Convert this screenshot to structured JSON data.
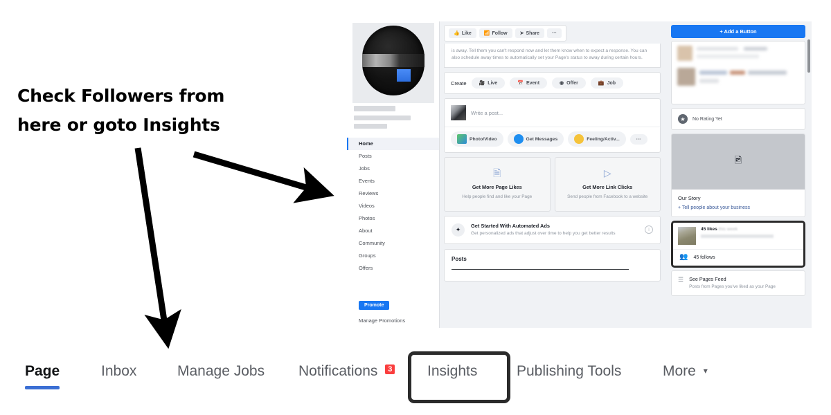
{
  "annotation": {
    "headline_line1": "Check Followers from",
    "headline_line2": "here or goto Insights",
    "arrow_to_stats": "arrow-pointing-to-followers-box",
    "arrow_to_insights": "arrow-pointing-to-insights-tab"
  },
  "tabbar": {
    "tabs": [
      {
        "label": "Page",
        "active": true,
        "badge": null
      },
      {
        "label": "Inbox",
        "active": false,
        "badge": null
      },
      {
        "label": "Manage Jobs",
        "active": false,
        "badge": null
      },
      {
        "label": "Notifications",
        "active": false,
        "badge": "3"
      },
      {
        "label": "Insights",
        "active": false,
        "badge": null,
        "highlighted": true
      },
      {
        "label": "Publishing Tools",
        "active": false,
        "badge": null
      },
      {
        "label": "More",
        "active": false,
        "badge": null,
        "caret": "▾"
      }
    ],
    "active_color": "#3b6fd4",
    "badge_color": "#fa3e3e",
    "highlight_color": "#2b2b2b"
  },
  "screenshot": {
    "left_nav": {
      "items": [
        {
          "label": "Home",
          "active": true
        },
        {
          "label": "Posts",
          "active": false
        },
        {
          "label": "Jobs",
          "active": false
        },
        {
          "label": "Events",
          "active": false
        },
        {
          "label": "Reviews",
          "active": false
        },
        {
          "label": "Videos",
          "active": false
        },
        {
          "label": "Photos",
          "active": false
        },
        {
          "label": "About",
          "active": false
        },
        {
          "label": "Community",
          "active": false
        },
        {
          "label": "Groups",
          "active": false
        },
        {
          "label": "Offers",
          "active": false
        }
      ],
      "promote_label": "Promote",
      "manage_promotions_label": "Manage Promotions"
    },
    "action_bar": {
      "like": "Like",
      "follow": "Follow",
      "share": "Share",
      "more": "···"
    },
    "away_message": "is away. Tell them you can't respond now and let them know when to expect a response. You can also schedule away times to automatically set your Page's status to away during certain hours.",
    "create_row": {
      "label": "Create",
      "items": [
        {
          "label": "Live",
          "icon": "video-camera-icon"
        },
        {
          "label": "Event",
          "icon": "calendar-icon"
        },
        {
          "label": "Offer",
          "icon": "tag-icon"
        },
        {
          "label": "Job",
          "icon": "briefcase-icon"
        }
      ]
    },
    "composer": {
      "placeholder": "Write a post...",
      "actions": [
        {
          "label": "Photo/Video",
          "icon": "photo-icon"
        },
        {
          "label": "Get Messages",
          "icon": "messenger-icon"
        },
        {
          "label": "Feeling/Activ...",
          "icon": "emoji-icon"
        },
        {
          "label": "···",
          "icon": "ellipsis-icon"
        }
      ]
    },
    "promo_cards": [
      {
        "title": "Get More Page Likes",
        "subtitle": "Help people find and like your Page",
        "icon": "page-list-icon"
      },
      {
        "title": "Get More Link Clicks",
        "subtitle": "Send people from Facebook to a website",
        "icon": "cursor-icon"
      }
    ],
    "automated_ads": {
      "title": "Get Started With Automated Ads",
      "subtitle": "Get personalized ads that adjust over time to help you get better results",
      "icon": "magic-wand-icon",
      "info_icon": "info-icon"
    },
    "posts_section": {
      "title": "Posts"
    },
    "right_column": {
      "add_button_label": "+ Add a Button",
      "rating_label": "No Rating Yet",
      "story": {
        "title": "Our Story",
        "link": "+ Tell people about your business",
        "image_icon": "image-placeholder-icon"
      },
      "stats": {
        "likes_value": "45 likes",
        "likes_note": "this week",
        "follows_value": "45 follows",
        "follows_icon": "followers-icon"
      },
      "pages_feed": {
        "title": "See Pages Feed",
        "subtitle": "Posts from Pages you've liked as your Page",
        "icon": "feed-list-icon"
      }
    }
  }
}
